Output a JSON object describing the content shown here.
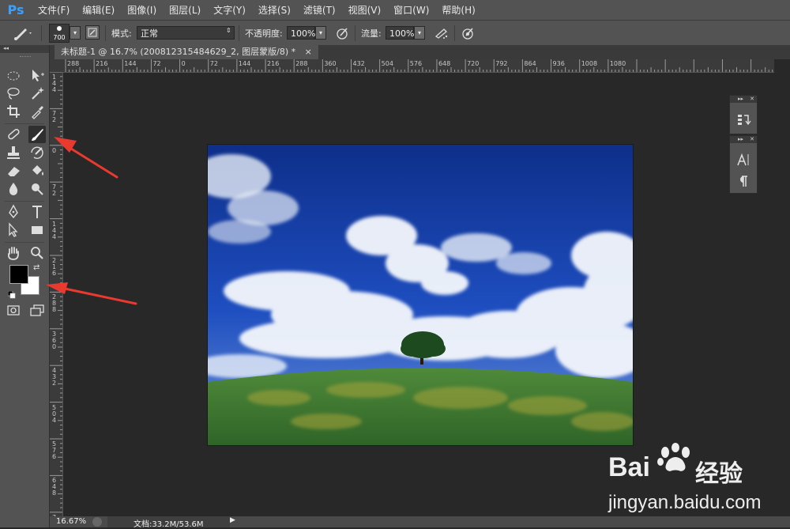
{
  "app": {
    "logo": "Ps",
    "menu": [
      "文件(F)",
      "编辑(E)",
      "图像(I)",
      "图层(L)",
      "文字(Y)",
      "选择(S)",
      "滤镜(T)",
      "视图(V)",
      "窗口(W)",
      "帮助(H)"
    ]
  },
  "options": {
    "brush_size": "700",
    "mode_label": "模式:",
    "mode_value": "正常",
    "opacity_label": "不透明度:",
    "opacity_value": "100%",
    "flow_label": "流量:",
    "flow_value": "100%"
  },
  "document": {
    "tab_title": "未标题-1 @ 16.7% (200812315484629_2, 图层蒙版/8) *",
    "close": "×"
  },
  "ruler_top": [
    "288",
    "216",
    "144",
    "72",
    "0",
    "72",
    "144",
    "216",
    "288",
    "360",
    "432",
    "504",
    "576",
    "648",
    "720",
    "792",
    "864",
    "936",
    "1008",
    "1080"
  ],
  "ruler_left": [
    [
      "1",
      "4",
      "4"
    ],
    [
      "7",
      "2"
    ],
    [
      "0"
    ],
    [
      "7",
      "2"
    ],
    [
      "1",
      "4",
      "4"
    ],
    [
      "2",
      "1",
      "6"
    ],
    [
      "2",
      "8",
      "8"
    ],
    [
      "3",
      "6",
      "0"
    ],
    [
      "4",
      "3",
      "2"
    ],
    [
      "5",
      "0",
      "4"
    ],
    [
      "5",
      "7",
      "6"
    ],
    [
      "6",
      "4",
      "8"
    ],
    [
      "7"
    ]
  ],
  "status": {
    "zoom": "16.67%",
    "doc_info": "文档:33.2M/53.6M"
  },
  "watermark": {
    "brand": "Bai",
    "brand_cn": "经验",
    "url": "jingyan.baidu.com"
  },
  "colors": {
    "accent_blue": "#3aa0ff",
    "arrow_red": "#e83a2e",
    "foreground": "#000000",
    "background": "#ffffff"
  }
}
